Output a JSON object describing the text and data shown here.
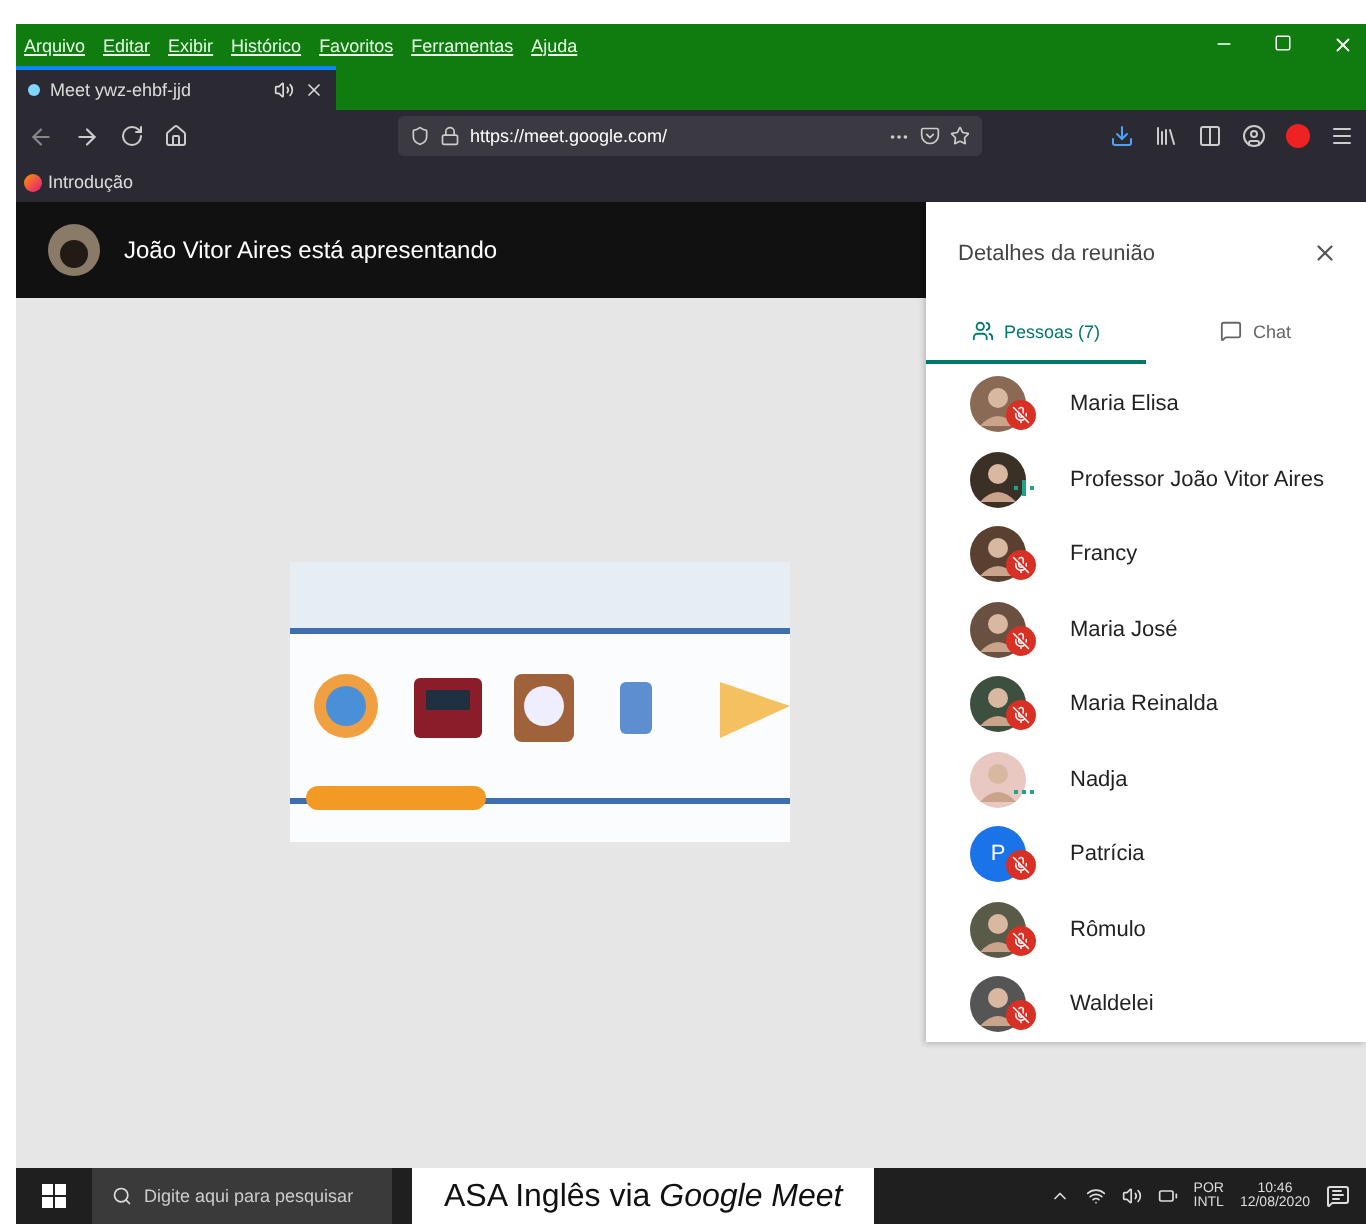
{
  "browser": {
    "menu": [
      "Arquivo",
      "Editar",
      "Exibir",
      "Histórico",
      "Favoritos",
      "Ferramentas",
      "Ajuda"
    ],
    "tab": {
      "title": "Meet ywz-ehbf-jjd",
      "audio": true
    },
    "url": "https://meet.google.com/",
    "bookmarks": [
      "Introdução"
    ]
  },
  "meet": {
    "presenter": "João Vitor Aires está apresentando",
    "panel": {
      "title": "Detalhes da reunião",
      "tabs": [
        {
          "label": "Pessoas (7)",
          "selected": true
        },
        {
          "label": "Chat",
          "selected": false
        }
      ],
      "participants": [
        {
          "name": "Maria Elisa",
          "muted": true,
          "speaking": false
        },
        {
          "name": "Professor João Vitor Aires",
          "muted": false,
          "speaking": true
        },
        {
          "name": "Francy",
          "muted": true,
          "speaking": false
        },
        {
          "name": "Maria José",
          "muted": true,
          "speaking": false
        },
        {
          "name": "Maria Reinalda",
          "muted": true,
          "speaking": false
        },
        {
          "name": "Nadja",
          "muted": false,
          "speaking": false
        },
        {
          "name": "Patrícia",
          "muted": true,
          "speaking": false,
          "initial": "P"
        },
        {
          "name": "Rômulo",
          "muted": true,
          "speaking": false
        },
        {
          "name": "Waldelei",
          "muted": true,
          "speaking": false
        }
      ]
    }
  },
  "taskbar": {
    "search_placeholder": "Digite aqui para pesquisar",
    "caption": "ASA Inglês via *Google Meet*",
    "language": [
      "POR",
      "INTL"
    ],
    "time": "10:46",
    "date": "12/08/2020"
  }
}
